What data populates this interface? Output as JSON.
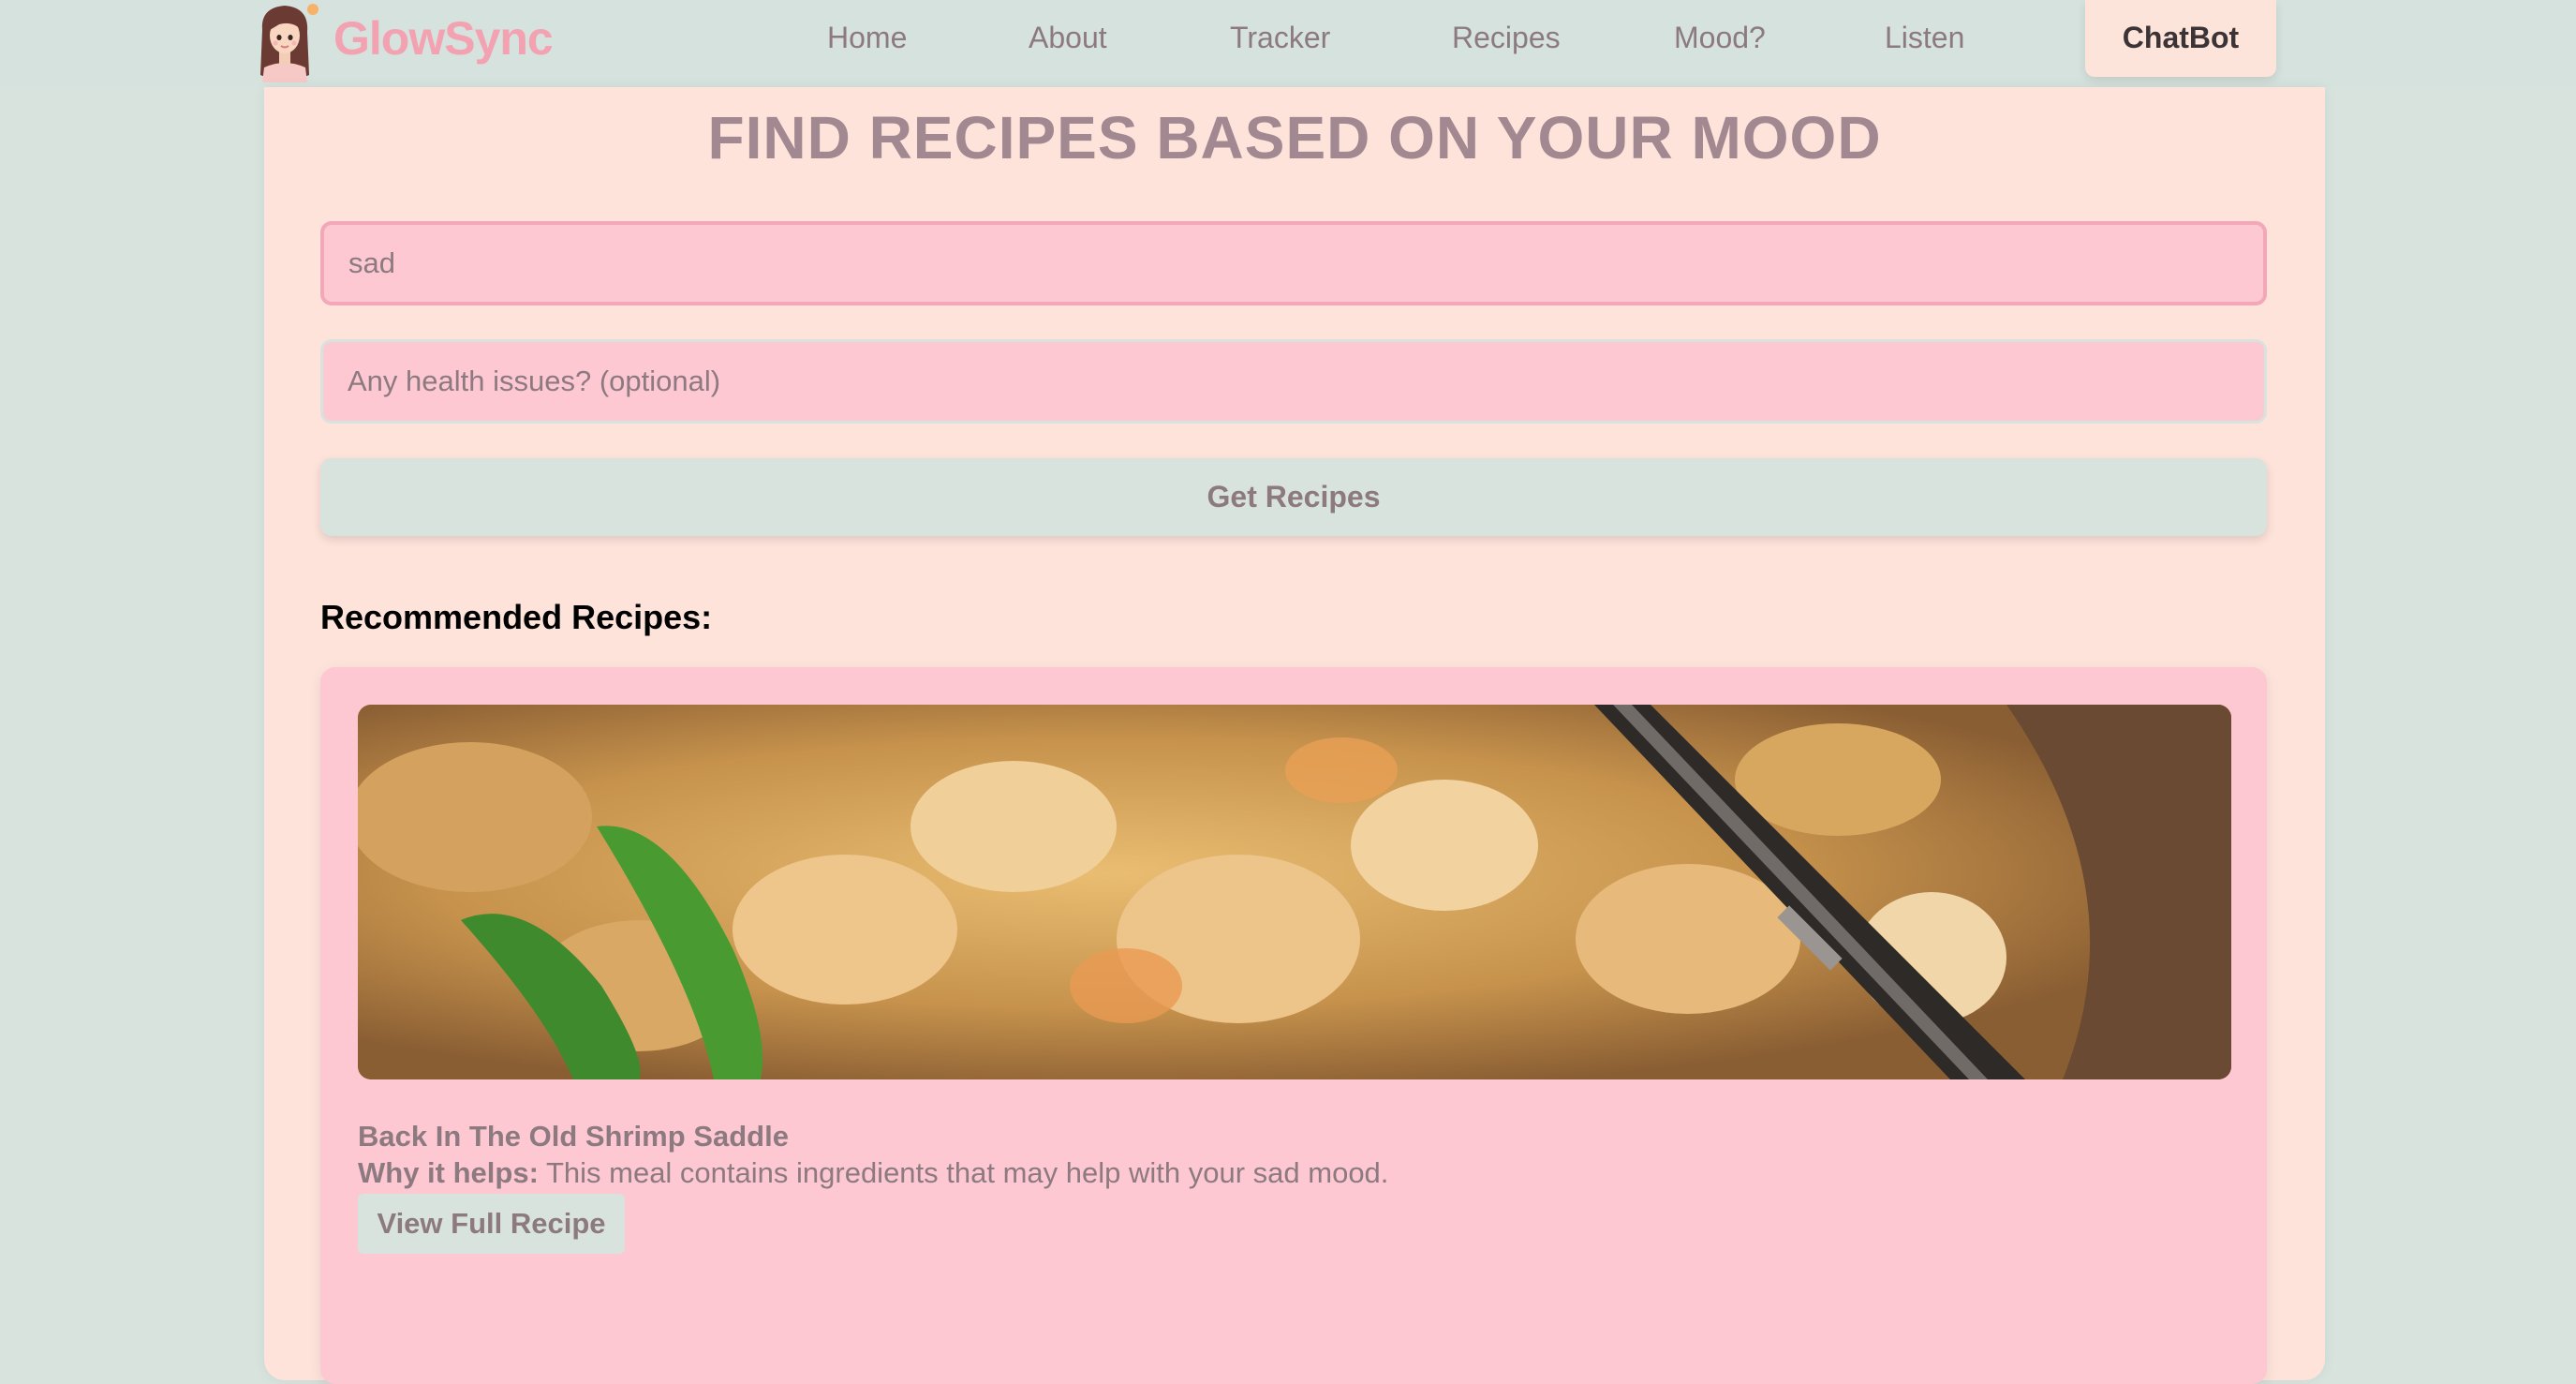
{
  "brand": {
    "name": "GlowSync"
  },
  "nav": {
    "items": [
      "Home",
      "About",
      "Tracker",
      "Recipes",
      "Mood?",
      "Listen"
    ],
    "chatbot_label": "ChatBot"
  },
  "main": {
    "title": "FIND RECIPES BASED ON YOUR MOOD",
    "mood_input": {
      "value": "sad"
    },
    "health_input": {
      "placeholder": "Any health issues? (optional)",
      "value": ""
    },
    "submit_label": "Get Recipes",
    "results_heading": "Recommended Recipes:"
  },
  "recipes": [
    {
      "title": "Back In The Old Shrimp Saddle",
      "why_label": "Why it helps:",
      "why_text": "This meal contains ingredients that may help with your sad mood.",
      "button_label": "View Full Recipe",
      "image_subject": "shrimp curry with green chilies and a spoon"
    }
  ],
  "colors": {
    "page_bg": "#d8e3de",
    "card_bg": "#fde3da",
    "field_bg": "#fdc8d2",
    "brand": "#f3a2b2",
    "muted_text": "#8c7a80",
    "title_text": "#a28890"
  }
}
